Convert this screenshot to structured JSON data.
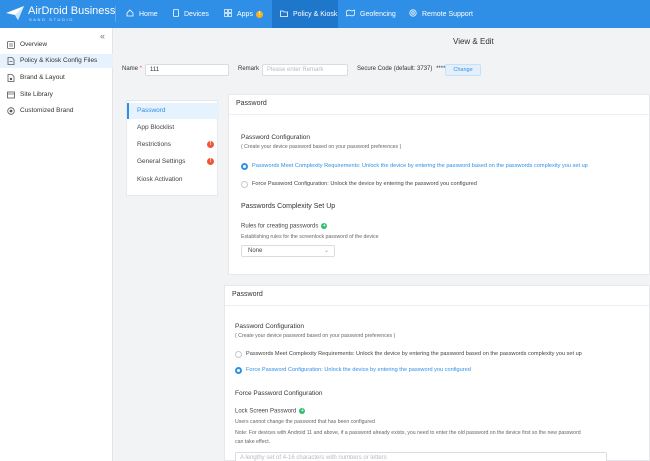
{
  "header": {
    "brand": "AirDroid Business",
    "brand_sub": "SAND STUDIO",
    "nav": [
      {
        "label": "Home",
        "icon": "home-icon"
      },
      {
        "label": "Devices",
        "icon": "phone-icon"
      },
      {
        "label": "Apps",
        "icon": "grid-icon",
        "badge": "!"
      },
      {
        "label": "Policy & Kiosk",
        "icon": "folder-icon"
      },
      {
        "label": "Geofencing",
        "icon": "map-icon"
      },
      {
        "label": "Remote Support",
        "icon": "support-icon"
      }
    ]
  },
  "sidebar": {
    "collapse": "«",
    "items": [
      {
        "label": "Overview",
        "icon": "overview-icon"
      },
      {
        "label": "Policy & Kiosk Config Files",
        "icon": "config-file-icon"
      },
      {
        "label": "Brand & Layout",
        "icon": "brand-icon"
      },
      {
        "label": "Site Library",
        "icon": "library-icon"
      },
      {
        "label": "Customized Brand",
        "icon": "target-icon"
      }
    ]
  },
  "page": {
    "title": "View & Edit",
    "name_label": "Name",
    "name_req": "*",
    "name_value": "111",
    "remark_label": "Remark",
    "remark_placeholder": "Please enter Remark",
    "secure_label": "Secure Code (default: 3737)",
    "secure_value": "****",
    "change_btn": "Change"
  },
  "tabs": [
    {
      "label": "Password",
      "active": true
    },
    {
      "label": "App Blocklist"
    },
    {
      "label": "Restrictions",
      "badge": "!"
    },
    {
      "label": "General Settings",
      "badge": "!"
    },
    {
      "label": "Kiosk Activation"
    }
  ],
  "card1": {
    "title": "Password",
    "config_title": "Password Configuration",
    "config_desc": "( Create your device password based on your password preferences )",
    "opt1": "Passwords Meet Complexity Requirements: Unlock the device by entering the password based on the passwords complexity you set up",
    "opt2": "Force Password Configuration: Unlock the device by entering the password you configured",
    "complexity_title": "Passwords Complexity Set Up",
    "rules_label": "Rules for creating passwords",
    "rules_desc": "Establishing rules for the screenlock password of the device",
    "rules_value": "None"
  },
  "card2": {
    "title": "Password",
    "config_title": "Password Configuration",
    "config_desc": "( Create your device password based on your password preferences )",
    "opt1": "Passwords Meet Complexity Requirements: Unlock the device by entering the password based on the passwords complexity you set up",
    "opt2": "Force Password Configuration: Unlock the device by entering the password you configured",
    "force_title": "Force Password Configuration",
    "lock_label": "Lock Screen Password",
    "lock_desc": "Users cannot change the password that has been configured",
    "note1": "Note: For devices with Android 11 and above, if a password already exists, you need to enter the old password on the device first so the new password",
    "note2": "can take effect.",
    "lock_placeholder": "A lengthy set of 4-16 characters with numbers or letters"
  },
  "colors": {
    "accent": "#2f8fe6",
    "topbar": "#2f8fe6",
    "warn": "#f0563a",
    "success": "#2ebd6b"
  }
}
